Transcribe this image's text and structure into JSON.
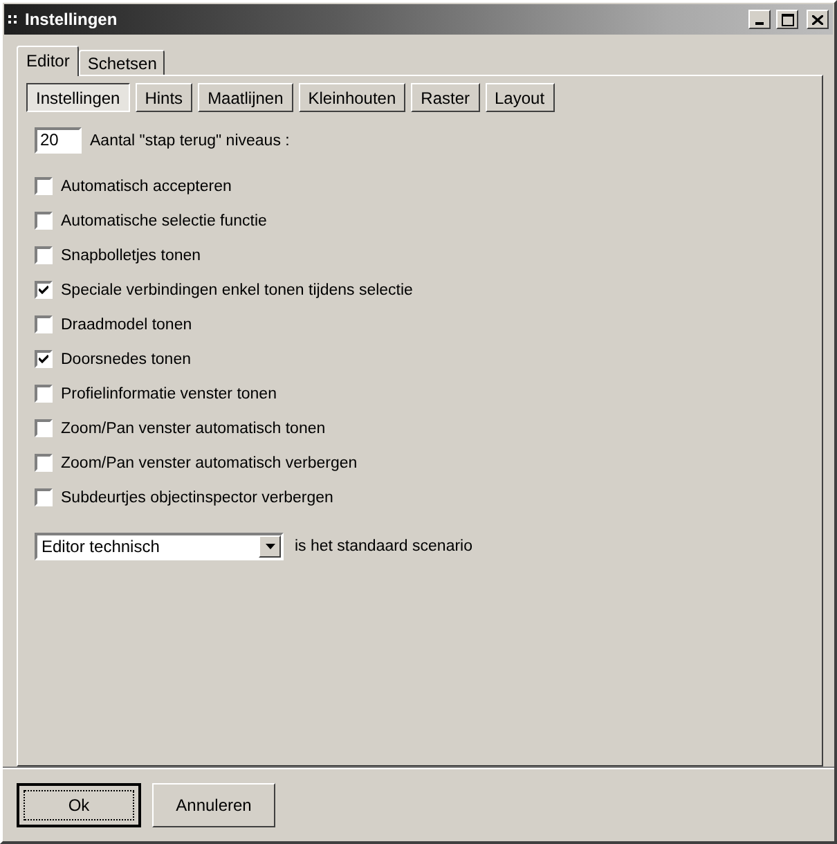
{
  "window": {
    "title": "Instellingen"
  },
  "tabs": [
    {
      "label": "Editor",
      "selected": true
    },
    {
      "label": "Schetsen",
      "selected": false
    }
  ],
  "subtabs": [
    {
      "label": "Instellingen",
      "selected": true
    },
    {
      "label": "Hints",
      "selected": false
    },
    {
      "label": "Maatlijnen",
      "selected": false
    },
    {
      "label": "Kleinhouten",
      "selected": false
    },
    {
      "label": "Raster",
      "selected": false
    },
    {
      "label": "Layout",
      "selected": false
    }
  ],
  "undo_levels": {
    "value": "20",
    "label": "Aantal \"stap terug\" niveaus :"
  },
  "options": [
    {
      "label": "Automatisch accepteren",
      "checked": false
    },
    {
      "label": "Automatische selectie functie",
      "checked": false
    },
    {
      "label": "Snapbolletjes tonen",
      "checked": false
    },
    {
      "label": "Speciale verbindingen enkel tonen tijdens selectie",
      "checked": true
    },
    {
      "label": "Draadmodel tonen",
      "checked": false
    },
    {
      "label": "Doorsnedes tonen",
      "checked": true
    },
    {
      "label": "Profielinformatie venster tonen",
      "checked": false
    },
    {
      "label": "Zoom/Pan venster automatisch tonen",
      "checked": false
    },
    {
      "label": "Zoom/Pan venster automatisch verbergen",
      "checked": false
    },
    {
      "label": "Subdeurtjes objectinspector verbergen",
      "checked": false
    }
  ],
  "scenario": {
    "value": "Editor technisch",
    "label": "is het standaard scenario"
  },
  "buttons": [
    {
      "label": "Ok",
      "default": true
    },
    {
      "label": "Annuleren",
      "default": false
    }
  ]
}
